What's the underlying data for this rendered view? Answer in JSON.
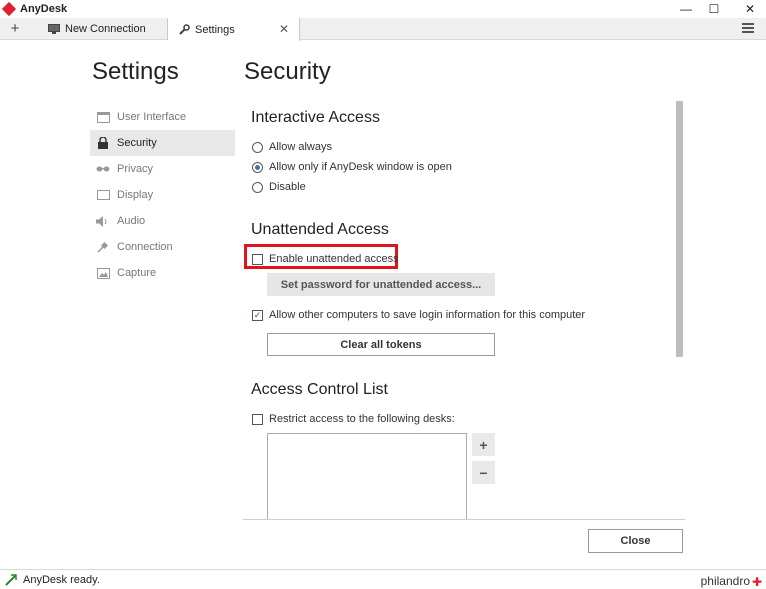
{
  "window": {
    "app_title": "AnyDesk",
    "minimize_glyph": "—",
    "maximize_glyph": "☐",
    "close_glyph": "✕",
    "brand_color": "#e0202a"
  },
  "tabs": {
    "add_glyph": "+",
    "items": [
      {
        "label": "New Connection",
        "icon": "monitor-icon"
      },
      {
        "label": "Settings",
        "icon": "wrench-icon",
        "close_glyph": "✕"
      }
    ]
  },
  "settings_heading": "Settings",
  "sidebar": {
    "items": [
      {
        "label": "User Interface",
        "icon": "window-icon"
      },
      {
        "label": "Security",
        "icon": "lock-icon",
        "active": true
      },
      {
        "label": "Privacy",
        "icon": "glasses-icon"
      },
      {
        "label": "Display",
        "icon": "display-icon"
      },
      {
        "label": "Audio",
        "icon": "speaker-icon"
      },
      {
        "label": "Connection",
        "icon": "plug-icon"
      },
      {
        "label": "Capture",
        "icon": "image-icon"
      }
    ]
  },
  "page_title": "Security",
  "interactive_access": {
    "title": "Interactive Access",
    "options": [
      {
        "label": "Allow always",
        "checked": false
      },
      {
        "label": "Allow only if AnyDesk window is open",
        "checked": true
      },
      {
        "label": "Disable",
        "checked": false
      }
    ]
  },
  "unattended_access": {
    "title": "Unattended Access",
    "enable_label": "Enable unattended access",
    "enable_checked": false,
    "set_password_button": "Set password for unattended access...",
    "allow_save_label": "Allow other computers to save login information for this computer",
    "allow_save_checked": true,
    "clear_tokens_button": "Clear all tokens",
    "highlight_color": "#e0141e"
  },
  "acl": {
    "title": "Access Control List",
    "restrict_label": "Restrict access to the following desks:",
    "restrict_checked": false,
    "add_glyph": "+",
    "remove_glyph": "−"
  },
  "close_button": "Close",
  "status": {
    "text": "AnyDesk ready.",
    "brand": "philandro"
  }
}
